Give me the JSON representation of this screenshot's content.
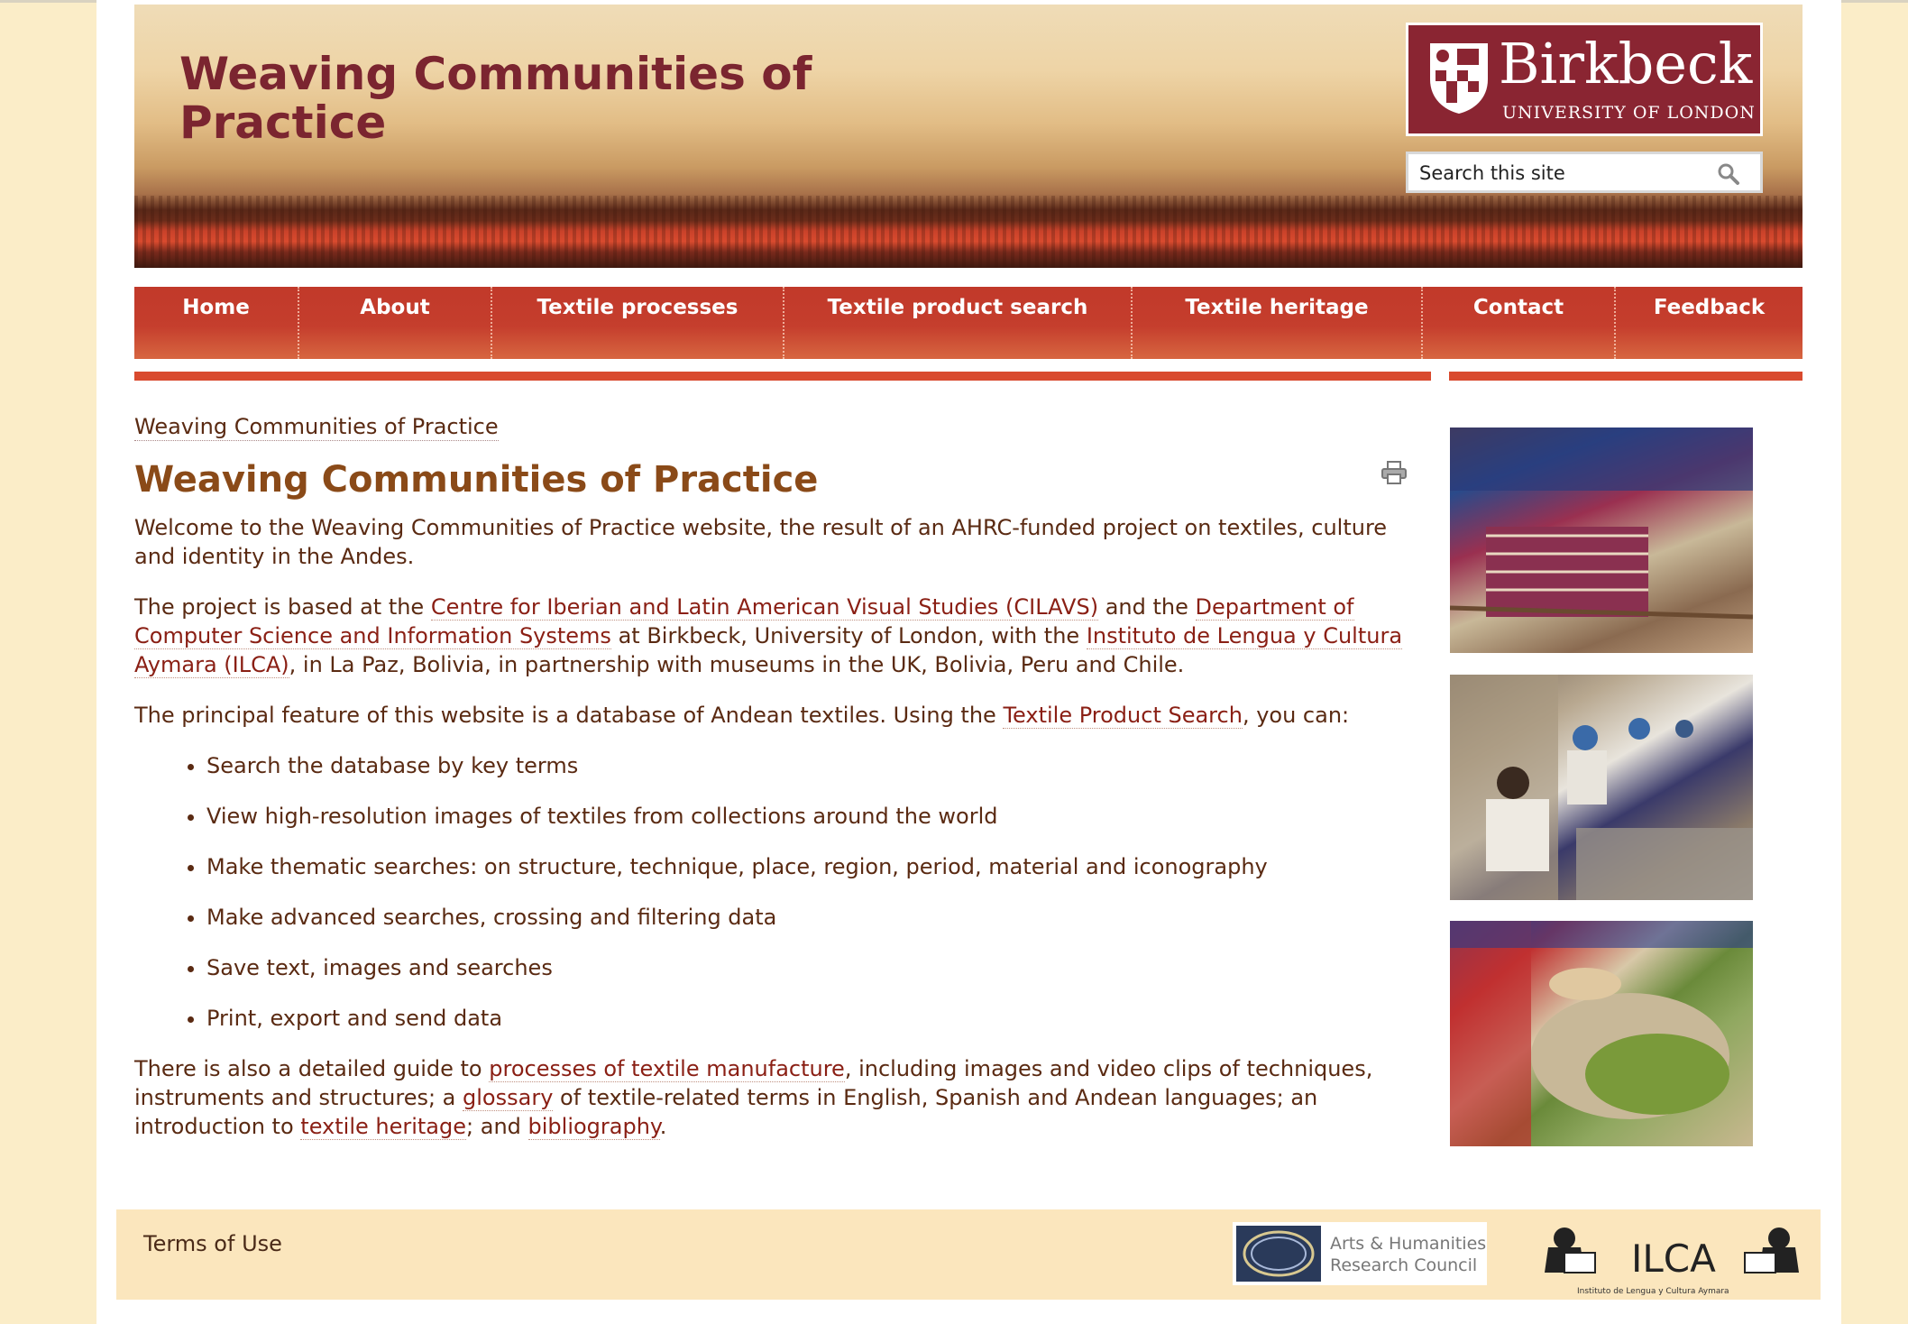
{
  "header": {
    "site_title": "Weaving Communities of Practice",
    "logo": {
      "name": "Birkbeck",
      "subtitle": "UNIVERSITY OF LONDON"
    },
    "search": {
      "placeholder": "Search this site",
      "icon": "search-icon"
    }
  },
  "nav": [
    {
      "label": "Home"
    },
    {
      "label": "About"
    },
    {
      "label": "Textile processes"
    },
    {
      "label": "Textile product search"
    },
    {
      "label": "Textile heritage"
    },
    {
      "label": "Contact"
    },
    {
      "label": "Feedback"
    }
  ],
  "main": {
    "breadcrumb": "Weaving Communities of Practice",
    "heading": "Weaving Communities of Practice",
    "print_icon": "print-icon",
    "intro": "Welcome to the Weaving Communities of Practice website, the result of an AHRC-funded project on textiles, culture and identity in the Andes.",
    "p2": {
      "t1": "The project is based at the ",
      "link1": "Centre for Iberian and Latin American Visual Studies (CILAVS)",
      "t2": " and the ",
      "link2": "Department of Computer Science and Information Systems",
      "t3": " at Birkbeck, University of London, with the ",
      "link3": "Instituto de Lengua y Cultura Aymara (ILCA)",
      "t4": ", in La Paz, Bolivia, in partnership with museums in the UK, Bolivia, Peru and Chile."
    },
    "p3": {
      "t1": "The principal feature of this website is a database of Andean textiles. Using the ",
      "link1": "Textile Product Search",
      "t2": ", you can:"
    },
    "features": [
      "Search the database by key terms",
      "View high-resolution images of textiles from collections around the world",
      "Make thematic searches: on structure, technique, place, region, period, material and iconography",
      "Make advanced searches, crossing and filtering data",
      "Save text, images and searches",
      "Print, export and send data"
    ],
    "p4": {
      "t1": "There is also a detailed guide to ",
      "link1": "processes of textile manufacture",
      "t2": ", including images and video clips of techniques, instruments and structures; a ",
      "link2": "glossary",
      "t3": " of textile-related terms in English, Spanish and Andean languages; an introduction to ",
      "link3": "textile heritage",
      "t4": "; and ",
      "link4": "bibliography",
      "t5": "."
    }
  },
  "sidebar": {
    "images": [
      "weaving-loom-photo",
      "weavers-group-photo",
      "textile-dyeing-photo"
    ]
  },
  "footer": {
    "terms": "Terms of Use",
    "ahrc": {
      "line1": "Arts & Humanities",
      "line2": "Research Council"
    },
    "ilca": {
      "name": "ILCA",
      "sub": "Instituto de Lengua y Cultura Aymara"
    }
  },
  "colors": {
    "title": "#7b2530",
    "heading": "#8a4a18",
    "link": "#8a1f14",
    "nav": "#c53e2d",
    "background": "#fbedc8",
    "logo_bg": "#8a2532"
  }
}
